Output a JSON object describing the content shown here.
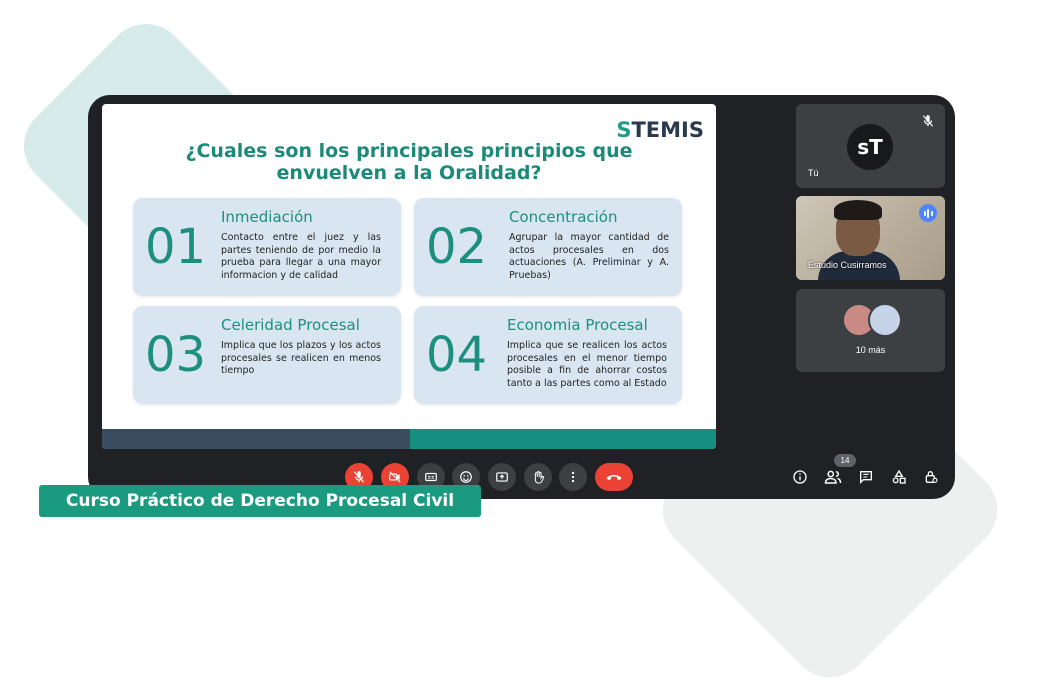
{
  "slide": {
    "logo_left": "S",
    "logo_right": "TEMIS",
    "title_line1": "¿Cuales son los principales principios que",
    "title_line2": "envuelven a la Oralidad?",
    "cards": [
      {
        "num": "01",
        "name": "Inmediación",
        "desc": "Contacto entre el juez y las partes teniendo de por medio la prueba para llegar a una mayor informacion y de calidad"
      },
      {
        "num": "02",
        "name": "Concentración",
        "desc": "Agrupar la mayor cantidad de actos procesales en dos actuaciones (A. Preliminar y A. Pruebas)"
      },
      {
        "num": "03",
        "name": "Celeridad Procesal",
        "desc": "Implica que los plazos y los actos procesales se realicen en menos tiempo"
      },
      {
        "num": "04",
        "name": "Economia Procesal",
        "desc": "Implica que se realicen los actos procesales en el menor tiempo posible a fin de ahorrar costos tanto a las partes como al Estado"
      }
    ]
  },
  "participants": {
    "self_avatar": "sT",
    "self_label": "Tú",
    "speaker_label": "Estudio Cusirramos",
    "others_label": "10 más"
  },
  "controls": {
    "participant_count": "14",
    "icons": [
      "mic-off-icon",
      "camera-off-icon",
      "captions-icon",
      "emoji-icon",
      "present-icon",
      "raise-hand-icon",
      "more-icon",
      "end-call-icon"
    ],
    "right_icons": [
      "info-icon",
      "people-icon",
      "chat-icon",
      "activities-icon",
      "host-controls-icon"
    ]
  },
  "banner": {
    "text": "Curso Práctico de Derecho Procesal Civil"
  },
  "colors": {
    "accent": "#1a9a7f",
    "slide_teal": "#1c8f7f",
    "card_bg": "#d9e6f1",
    "window_bg": "#202124",
    "danger": "#ea4335"
  }
}
